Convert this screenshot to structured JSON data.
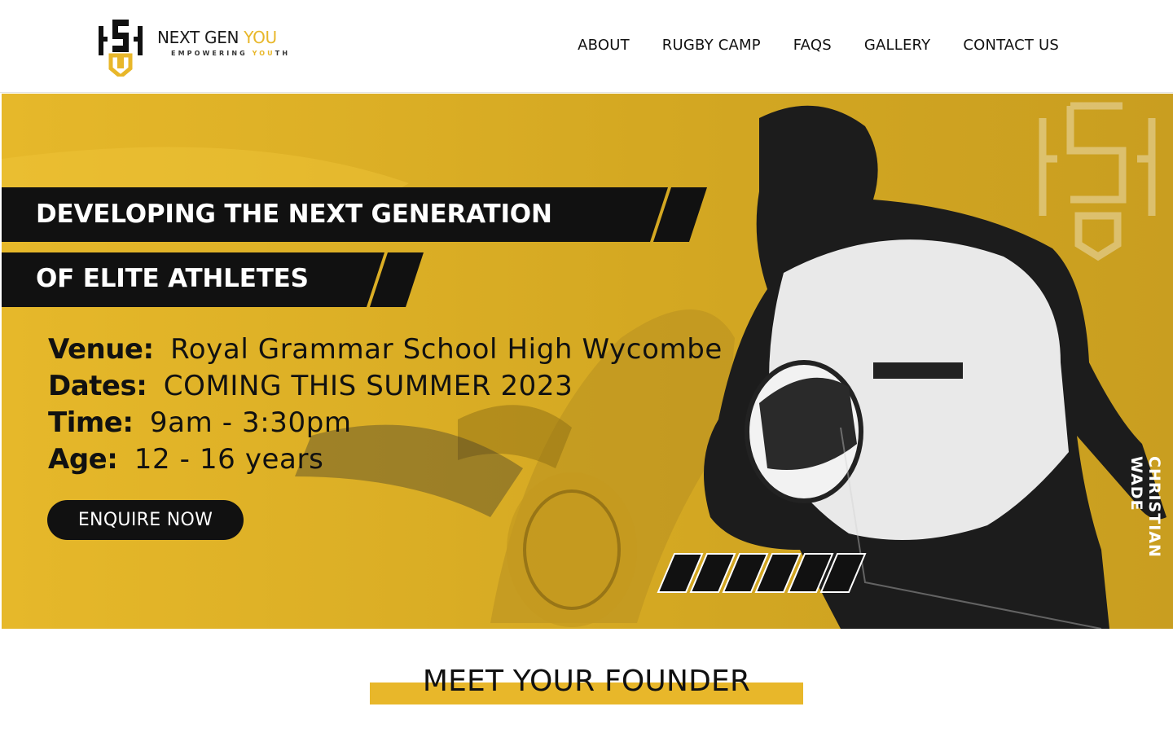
{
  "brand": {
    "name_part1": "NEXT GEN ",
    "name_part2": "YOU",
    "tagline_part1": "EMPOWERING ",
    "tagline_part2": "YOU",
    "tagline_part3": "TH",
    "accent_color": "#e8b72a"
  },
  "nav": {
    "items": [
      "ABOUT",
      "RUGBY CAMP",
      "FAQS",
      "GALLERY",
      "CONTACT US"
    ]
  },
  "hero": {
    "headline_line1": "DEVELOPING THE NEXT GENERATION",
    "headline_line2": "OF ELITE ATHLETES",
    "venue_label": "Venue:",
    "venue_value": "Royal Grammar School High Wycombe",
    "dates_label": "Dates:",
    "dates_value": "COMING THIS SUMMER 2023",
    "time_label": "Time:",
    "time_value": "9am - 3:30pm",
    "age_label": "Age:",
    "age_value": "12 - 16 years",
    "cta_label": "ENQUIRE NOW",
    "athlete_name": "CHRISTIAN WADE",
    "background_color": "#e3b627"
  },
  "founder": {
    "heading": "MEET YOUR FOUNDER"
  }
}
